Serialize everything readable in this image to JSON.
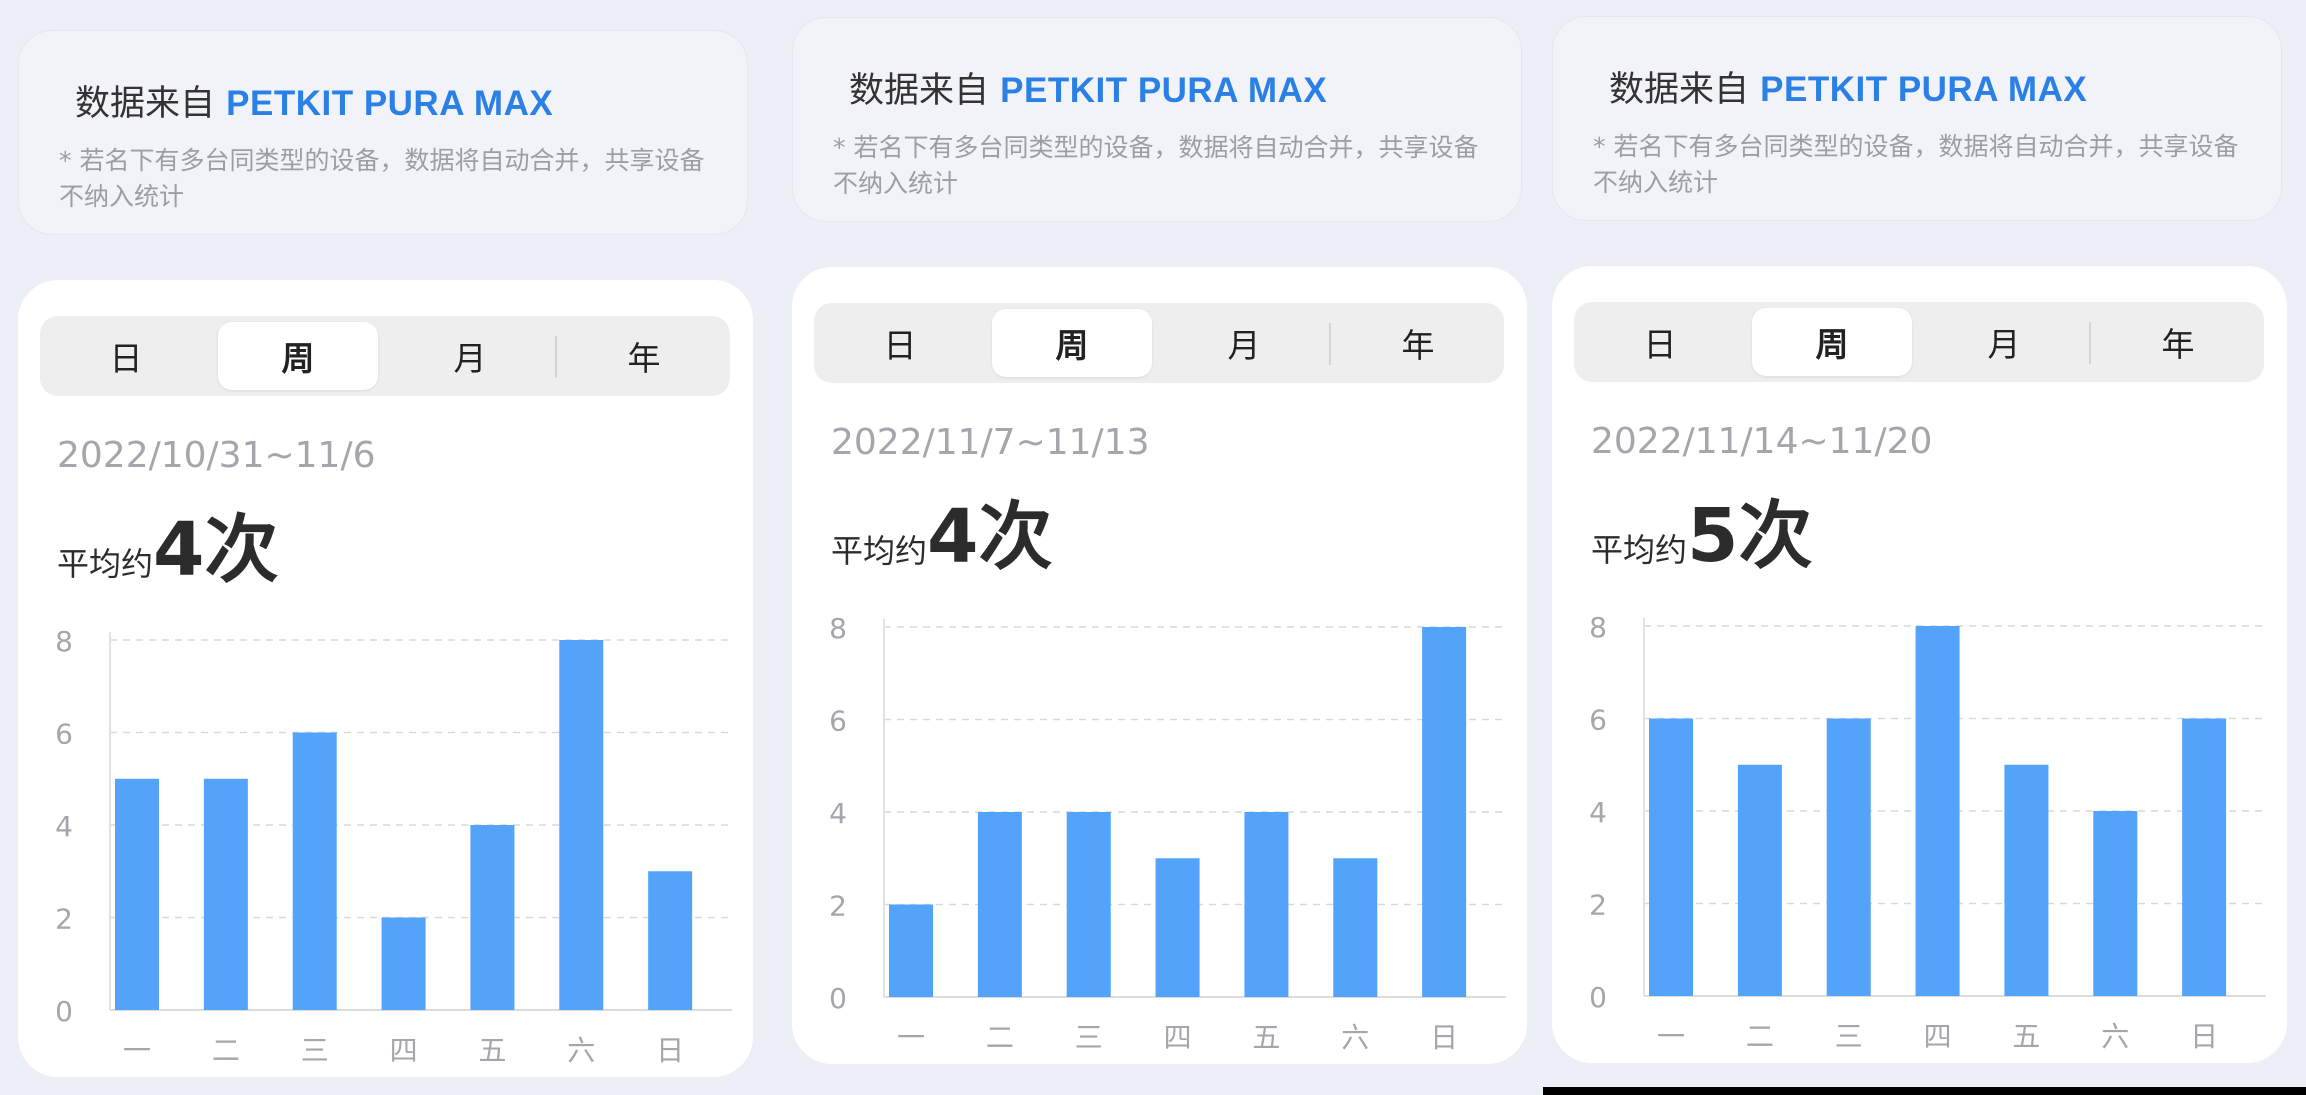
{
  "panels": [
    {
      "info": {
        "prefix": "数据来自 ",
        "brand": "PETKIT PURA MAX",
        "note": "* 若名下有多台同类型的设备，数据将自动合并，共享设备不纳入统计"
      },
      "tabs": [
        "日",
        "周",
        "月",
        "年"
      ],
      "active_tab": "周",
      "date_range": "2022/10/31~11/6",
      "avg_prefix": "平均约",
      "avg_value": "4次"
    },
    {
      "info": {
        "prefix": "数据来自 ",
        "brand": "PETKIT PURA MAX",
        "note": "* 若名下有多台同类型的设备，数据将自动合并，共享设备不纳入统计"
      },
      "tabs": [
        "日",
        "周",
        "月",
        "年"
      ],
      "active_tab": "周",
      "date_range": "2022/11/7~11/13",
      "avg_prefix": "平均约",
      "avg_value": "4次"
    },
    {
      "info": {
        "prefix": "数据来自 ",
        "brand": "PETKIT PURA MAX",
        "note": "* 若名下有多台同类型的设备，数据将自动合并，共享设备不纳入统计"
      },
      "tabs": [
        "日",
        "周",
        "月",
        "年"
      ],
      "active_tab": "周",
      "date_range": "2022/11/14~11/20",
      "avg_prefix": "平均约",
      "avg_value": "5次"
    }
  ],
  "colors": {
    "bar": "#52a3f9",
    "brand": "#2b80e6",
    "grid": "#d9d9d9",
    "tick": "#a3a6ab"
  },
  "chart_data": [
    {
      "type": "bar",
      "categories": [
        "一",
        "二",
        "三",
        "四",
        "五",
        "六",
        "日"
      ],
      "values": [
        5,
        5,
        6,
        2,
        4,
        8,
        3
      ],
      "ylim": [
        0,
        8
      ],
      "yticks": [
        0,
        2,
        4,
        6,
        8
      ],
      "grid": true
    },
    {
      "type": "bar",
      "categories": [
        "一",
        "二",
        "三",
        "四",
        "五",
        "六",
        "日"
      ],
      "values": [
        2,
        4,
        4,
        3,
        4,
        3,
        8
      ],
      "ylim": [
        0,
        8
      ],
      "yticks": [
        0,
        2,
        4,
        6,
        8
      ],
      "grid": true
    },
    {
      "type": "bar",
      "categories": [
        "一",
        "二",
        "三",
        "四",
        "五",
        "六",
        "日"
      ],
      "values": [
        6,
        5,
        6,
        8,
        5,
        4,
        6
      ],
      "ylim": [
        0,
        8
      ],
      "yticks": [
        0,
        2,
        4,
        6,
        8
      ],
      "grid": true
    }
  ]
}
